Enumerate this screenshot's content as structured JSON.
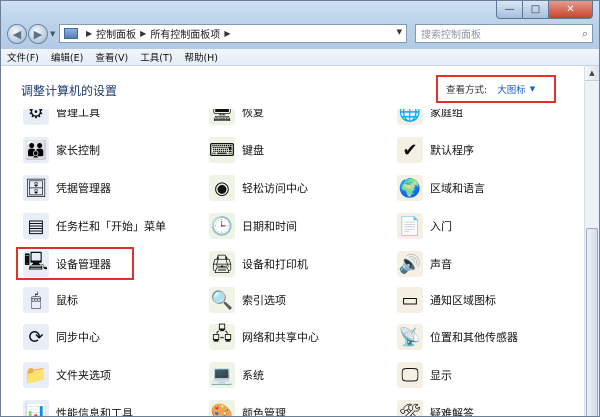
{
  "address": {
    "crumb1": "控制面板",
    "crumb2": "所有控制面板项"
  },
  "search": {
    "placeholder": "搜索控制面板"
  },
  "menu": [
    "文件(F)",
    "编辑(E)",
    "查看(V)",
    "工具(T)",
    "帮助(H)"
  ],
  "window_controls": {
    "minimize": "—",
    "maximize": "□",
    "close": "✕"
  },
  "page_title": "调整计算机的设置",
  "view": {
    "label": "查看方式:",
    "value": "大图标",
    "caret": "▼"
  },
  "columns": [
    [
      {
        "label": "管理工具",
        "icon": "admin-tools-icon",
        "glyph": "⚙"
      },
      {
        "label": "家长控制",
        "icon": "parental-controls-icon",
        "glyph": "👪"
      },
      {
        "label": "凭据管理器",
        "icon": "credential-manager-icon",
        "glyph": "🗄"
      },
      {
        "label": "任务栏和「开始」菜单",
        "icon": "taskbar-start-menu-icon",
        "glyph": "▤"
      },
      {
        "label": "设备管理器",
        "icon": "device-manager-icon",
        "glyph": "🖳"
      },
      {
        "label": "鼠标",
        "icon": "mouse-icon",
        "glyph": "🖱"
      },
      {
        "label": "同步中心",
        "icon": "sync-center-icon",
        "glyph": "⟳"
      },
      {
        "label": "文件夹选项",
        "icon": "folder-options-icon",
        "glyph": "📁"
      },
      {
        "label": "性能信息和工具",
        "icon": "performance-tools-icon",
        "glyph": "📊"
      }
    ],
    [
      {
        "label": "恢复",
        "icon": "recovery-icon",
        "glyph": "🖥"
      },
      {
        "label": "键盘",
        "icon": "keyboard-icon",
        "glyph": "⌨"
      },
      {
        "label": "轻松访问中心",
        "icon": "ease-of-access-icon",
        "glyph": "◉"
      },
      {
        "label": "日期和时间",
        "icon": "date-time-icon",
        "glyph": "🕒"
      },
      {
        "label": "设备和打印机",
        "icon": "devices-printers-icon",
        "glyph": "🖨"
      },
      {
        "label": "索引选项",
        "icon": "indexing-options-icon",
        "glyph": "🔍"
      },
      {
        "label": "网络和共享中心",
        "icon": "network-sharing-icon",
        "glyph": "🖧"
      },
      {
        "label": "系统",
        "icon": "system-icon",
        "glyph": "💻"
      },
      {
        "label": "颜色管理",
        "icon": "color-management-icon",
        "glyph": "🎨"
      }
    ],
    [
      {
        "label": "家庭组",
        "icon": "homegroup-icon",
        "glyph": "🌐"
      },
      {
        "label": "默认程序",
        "icon": "default-programs-icon",
        "glyph": "✔"
      },
      {
        "label": "区域和语言",
        "icon": "region-language-icon",
        "glyph": "🌍"
      },
      {
        "label": "入门",
        "icon": "getting-started-icon",
        "glyph": "📄"
      },
      {
        "label": "声音",
        "icon": "sound-icon",
        "glyph": "🔊"
      },
      {
        "label": "通知区域图标",
        "icon": "notification-area-icon",
        "glyph": "▭"
      },
      {
        "label": "位置和其他传感器",
        "icon": "location-sensors-icon",
        "glyph": "📡"
      },
      {
        "label": "显示",
        "icon": "display-icon",
        "glyph": "🖵"
      },
      {
        "label": "疑难解答",
        "icon": "troubleshooting-icon",
        "glyph": "🛠"
      }
    ]
  ],
  "colors": {
    "title": "#1d3a6b",
    "link": "#1b5fbd",
    "highlight": "#e0322b"
  }
}
